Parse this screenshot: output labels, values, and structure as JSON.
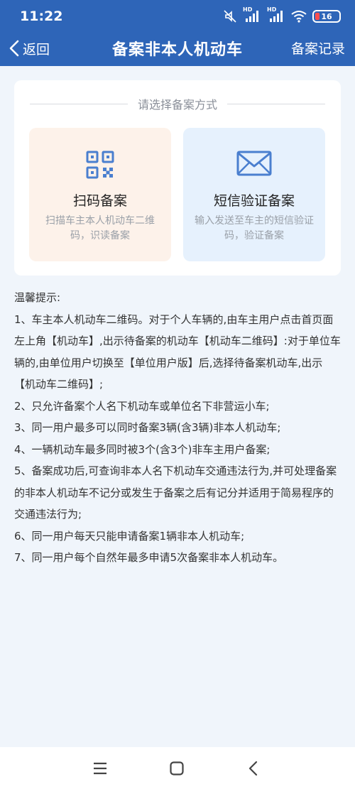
{
  "status": {
    "time": "11:22",
    "battery": "16",
    "signal_labels": [
      "HD",
      "HD"
    ]
  },
  "nav": {
    "back_label": "返回",
    "title": "备案非本人机动车",
    "right_label": "备案记录"
  },
  "card": {
    "header": "请选择备案方式",
    "options": [
      {
        "icon": "qr-code-icon",
        "title": "扫码备案",
        "desc": "扫描车主本人机动车二维码，识读备案"
      },
      {
        "icon": "envelope-icon",
        "title": "短信验证备案",
        "desc": "输入发送至车主的短信验证码，验证备案"
      }
    ]
  },
  "tips": {
    "title": "温馨提示:",
    "items": [
      "1、车主本人机动车二维码。对于个人车辆的,由车主用户点击首页面左上角【机动车】,出示待备案的机动车【机动车二维码】:对于单位车辆的,由单位用户切换至【单位用户版】后,选择待备案机动车,出示【机动车二维码】;",
      "2、只允许备案个人名下机动车或单位名下非营运小车;",
      "3、同一用户最多可以同时备案3辆(含3辆)非本人机动车;",
      "4、一辆机动车最多同时被3个(含3个)非车主用户备案;",
      "5、备案成功后,可查询非本人名下机动车交通违法行为,并可处理备案的非本人机动车不记分或发生于备案之后有记分并适用于简易程序的交通违法行为;",
      "6、同一用户每天只能申请备案1辆非本人机动车;",
      "7、同一用户每个自然年最多申请5次备案非本人机动车。"
    ]
  },
  "colors": {
    "header_bg": "#2e65b8",
    "page_bg": "#f0f5fb",
    "scan_bg": "#fdf2ea",
    "sms_bg": "#e6f1fd",
    "icon_blue": "#4a7fcf"
  }
}
